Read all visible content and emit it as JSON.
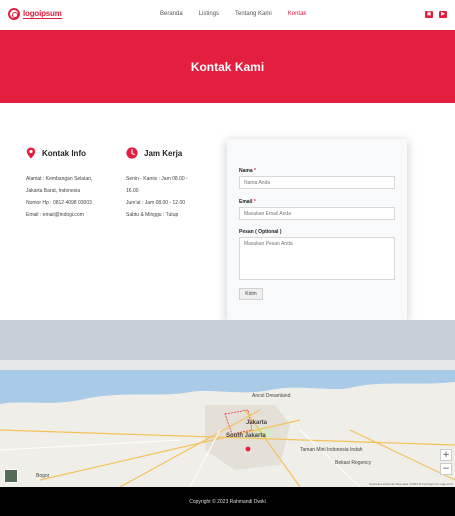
{
  "header": {
    "logo_text": "logoipsum",
    "nav": [
      "Beranda",
      "Listings",
      "Tentang Kami",
      "Kontak"
    ],
    "active_nav": "Kontak",
    "social_icons": [
      "instagram-icon",
      "youtube-icon"
    ]
  },
  "hero": {
    "title": "Kontak Kami"
  },
  "contact_info": {
    "title": "Kontak Info",
    "icon": "location-pin-icon",
    "lines": [
      "Alamat : Kembangan Selatan,",
      "Jakarta Barat, Indonesia",
      "Nomor Hp : 0812 4098 03003",
      "Email : email@indogi.com"
    ]
  },
  "work_hours": {
    "title": "Jam Kerja",
    "icon": "clock-icon",
    "lines": [
      "Senin - Kamis : Jam 08.00 -",
      "16.00",
      "Jum'at : Jam 08.00 - 12.00",
      "Sabtu & Minggu : Tutup"
    ]
  },
  "form": {
    "name_label": "Nama",
    "name_placeholder": "Nama Anda",
    "email_label": "Email",
    "email_placeholder": "Masukan Email Anda",
    "message_label": "Pesan ( Optional )",
    "message_placeholder": "Masukan Pesan Anda",
    "required_mark": "*",
    "submit_label": "Kirim"
  },
  "map": {
    "labels": [
      "Jakarta",
      "South Jakarta",
      "Ancol Dreamland",
      "Bekasi Regency",
      "Taman Mini Indonesia Indah",
      "Bogor"
    ],
    "zoom_in": "+",
    "zoom_out": "−",
    "attribution": "Keyboard shortcuts  Map data ©2023  Terms  Report a map error"
  },
  "footer": {
    "copyright": "Copyright © 2023 Rahmandi Dwiki"
  },
  "colors": {
    "accent": "#e41e3f",
    "footer_bg": "#000000"
  }
}
